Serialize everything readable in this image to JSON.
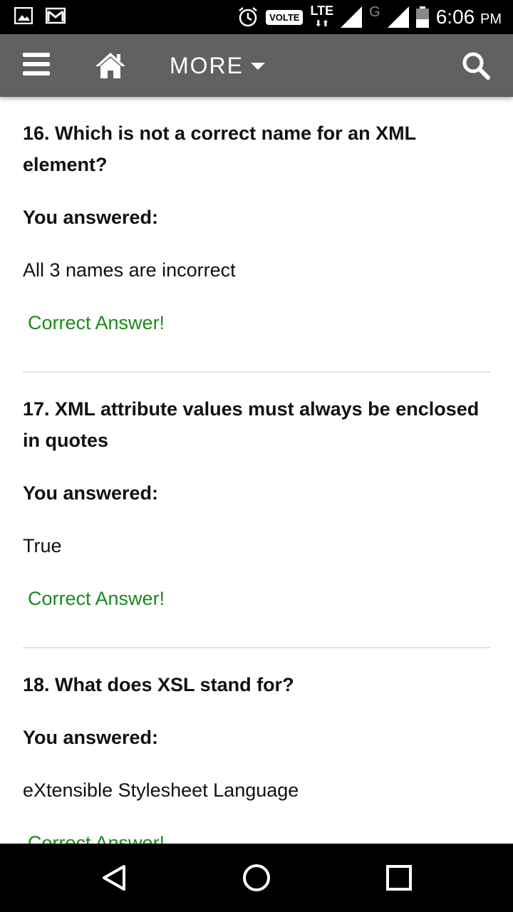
{
  "status_bar": {
    "time": "6:06",
    "ampm": "PM",
    "volte": "VOLTE",
    "lte": "LTE",
    "g": "G",
    "icons": [
      "image-icon",
      "gmail-icon",
      "alarm-icon",
      "signal-icon",
      "battery-icon"
    ]
  },
  "toolbar": {
    "more_label": "MORE",
    "icons": [
      "menu-icon",
      "home-icon",
      "caret-down-icon",
      "search-icon"
    ],
    "bg_color": "#616161"
  },
  "questions": [
    {
      "question": "16. Which is not a correct name for an XML element?",
      "you_answered": "You answered:",
      "answer": "All 3 names are incorrect",
      "verdict": "Correct Answer!"
    },
    {
      "question": "17. XML attribute values must always be enclosed in quotes",
      "you_answered": "You answered:",
      "answer": "True",
      "verdict": "Correct Answer!"
    },
    {
      "question": "18. What does XSL stand for?",
      "you_answered": "You answered:",
      "answer": "eXtensible Stylesheet Language",
      "verdict": "Correct Answer!"
    }
  ],
  "colors": {
    "correct": "#1b8a1b",
    "divider": "#e3e3e3"
  },
  "nav_bar": {
    "icons": [
      "back-icon",
      "home-circle-icon",
      "recents-icon"
    ]
  }
}
